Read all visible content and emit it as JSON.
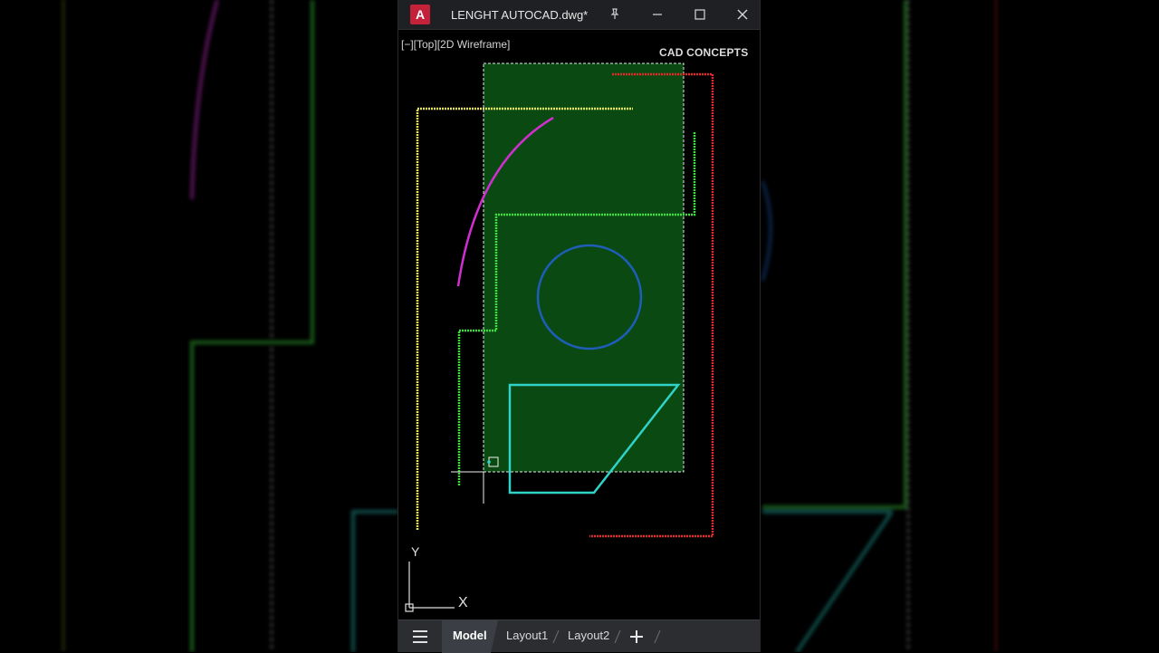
{
  "window": {
    "app_icon_letter": "A",
    "document_title": "LENGHT AUTOCAD.dwg*"
  },
  "viewport": {
    "label": "[−][Top][2D Wireframe]",
    "watermark": "CAD CONCEPTS"
  },
  "ucs": {
    "x_label": "X",
    "y_label": "Y"
  },
  "tabs": [
    {
      "label": "Model",
      "active": true
    },
    {
      "label": "Layout1",
      "active": false
    },
    {
      "label": "Layout2",
      "active": false
    }
  ],
  "colors": {
    "selection_fill": "#0a4a12",
    "yellow_line": "#e8e85a",
    "magenta_arc": "#d02fd0",
    "green_line": "#3fe03f",
    "blue_circle": "#1e5db8",
    "cyan_shape": "#2fd3c8",
    "red_line": "#e42a2a",
    "accent": "#c4213a"
  },
  "icons": [
    "pin-icon",
    "minimize-icon",
    "maximize-icon",
    "close-icon",
    "hamburger-menu-icon",
    "plus-icon"
  ]
}
